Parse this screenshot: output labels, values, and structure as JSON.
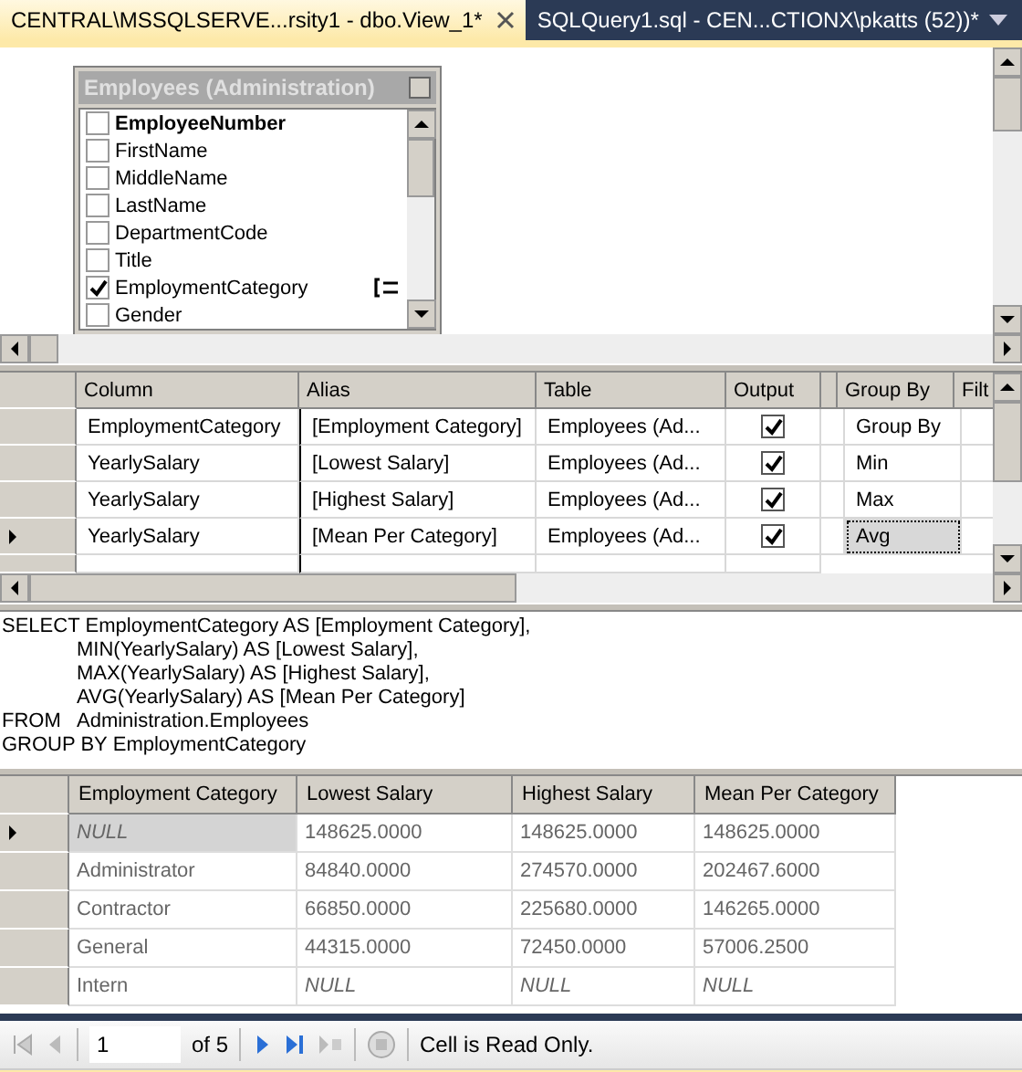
{
  "tabs": [
    {
      "label": "CENTRAL\\MSSQLSERVE...rsity1 - dbo.View_1*",
      "selected": true
    },
    {
      "label": "SQLQuery1.sql - CEN...CTIONX\\pkatts (52))*",
      "selected": false
    }
  ],
  "table_box": {
    "title": "Employees (Administration)",
    "columns": [
      {
        "name": "EmployeeNumber",
        "checked": false,
        "key": true,
        "grouped": false
      },
      {
        "name": "FirstName",
        "checked": false,
        "key": false,
        "grouped": false
      },
      {
        "name": "MiddleName",
        "checked": false,
        "key": false,
        "grouped": false
      },
      {
        "name": "LastName",
        "checked": false,
        "key": false,
        "grouped": false
      },
      {
        "name": "DepartmentCode",
        "checked": false,
        "key": false,
        "grouped": false
      },
      {
        "name": "Title",
        "checked": false,
        "key": false,
        "grouped": false
      },
      {
        "name": "EmploymentCategory",
        "checked": true,
        "key": false,
        "grouped": true
      },
      {
        "name": "Gender",
        "checked": false,
        "key": false,
        "grouped": false
      }
    ]
  },
  "criteria": {
    "columns": [
      "Column",
      "Alias",
      "Table",
      "Output",
      "Group By",
      "Filt"
    ],
    "rows": [
      {
        "column": "EmploymentCategory",
        "alias": "[Employment Category]",
        "table": "Employees (Ad...",
        "output": true,
        "group_by": "Group By",
        "current": false
      },
      {
        "column": "YearlySalary",
        "alias": "[Lowest Salary]",
        "table": "Employees (Ad...",
        "output": true,
        "group_by": "Min",
        "current": false
      },
      {
        "column": "YearlySalary",
        "alias": "[Highest Salary]",
        "table": "Employees (Ad...",
        "output": true,
        "group_by": "Max",
        "current": false
      },
      {
        "column": "YearlySalary",
        "alias": "[Mean Per Category]",
        "table": "Employees (Ad...",
        "output": true,
        "group_by": "Avg",
        "current": true
      }
    ]
  },
  "sql": [
    {
      "keyword": "SELECT",
      "text": "EmploymentCategory AS [Employment Category],"
    },
    {
      "text": "MIN(YearlySalary) AS [Lowest Salary],"
    },
    {
      "text": "MAX(YearlySalary) AS [Highest Salary],"
    },
    {
      "text": "AVG(YearlySalary) AS [Mean Per Category]"
    },
    {
      "keyword": "FROM",
      "text": "Administration.Employees"
    },
    {
      "keyword": "GROUP BY",
      "text": "EmploymentCategory"
    }
  ],
  "results": {
    "columns": [
      "Employment Category",
      "Lowest Salary",
      "Highest Salary",
      "Mean Per Category"
    ],
    "rows": [
      {
        "current": true,
        "cells": [
          {
            "text": "NULL",
            "is_null": true
          },
          {
            "text": "148625.0000"
          },
          {
            "text": "148625.0000"
          },
          {
            "text": "148625.0000"
          }
        ]
      },
      {
        "current": false,
        "cells": [
          {
            "text": "Administrator"
          },
          {
            "text": "84840.0000"
          },
          {
            "text": "274570.0000"
          },
          {
            "text": "202467.6000"
          }
        ]
      },
      {
        "current": false,
        "cells": [
          {
            "text": "Contractor"
          },
          {
            "text": "66850.0000"
          },
          {
            "text": "225680.0000"
          },
          {
            "text": "146265.0000"
          }
        ]
      },
      {
        "current": false,
        "cells": [
          {
            "text": "General"
          },
          {
            "text": "44315.0000"
          },
          {
            "text": "72450.0000"
          },
          {
            "text": "57006.2500"
          }
        ]
      },
      {
        "current": false,
        "cells": [
          {
            "text": "Intern"
          },
          {
            "text": "NULL",
            "is_null": true
          },
          {
            "text": "NULL",
            "is_null": true
          },
          {
            "text": "NULL",
            "is_null": true
          }
        ]
      }
    ]
  },
  "navigator": {
    "page": "1",
    "of": "of 5",
    "status": "Cell is Read Only."
  }
}
